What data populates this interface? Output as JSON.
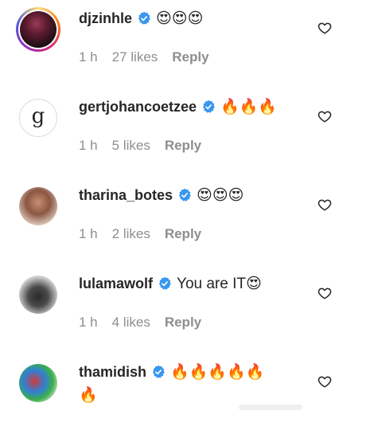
{
  "comments": [
    {
      "username": "djzinhle",
      "verified": true,
      "text": "😍😍😍",
      "time": "1 h",
      "likes": "27 likes",
      "reply": "Reply"
    },
    {
      "username": "gertjohancoetzee",
      "verified": true,
      "text": "🔥🔥🔥",
      "avatar_letter": "g",
      "time": "1 h",
      "likes": "5 likes",
      "reply": "Reply"
    },
    {
      "username": "tharina_botes",
      "verified": true,
      "text": "😍😍😍",
      "time": "1 h",
      "likes": "2 likes",
      "reply": "Reply"
    },
    {
      "username": "lulamawolf",
      "verified": true,
      "text": "You are IT😍",
      "time": "1 h",
      "likes": "4 likes",
      "reply": "Reply"
    },
    {
      "username": "thamidish",
      "verified": true,
      "text": "🔥🔥🔥🔥🔥",
      "text_wrap": "🔥"
    }
  ],
  "colors": {
    "verified": "#3897f0",
    "muted": "#8e8e8e",
    "text": "#262626"
  },
  "icons": {
    "verified": "verified-badge-icon",
    "like": "heart-outline-icon"
  }
}
